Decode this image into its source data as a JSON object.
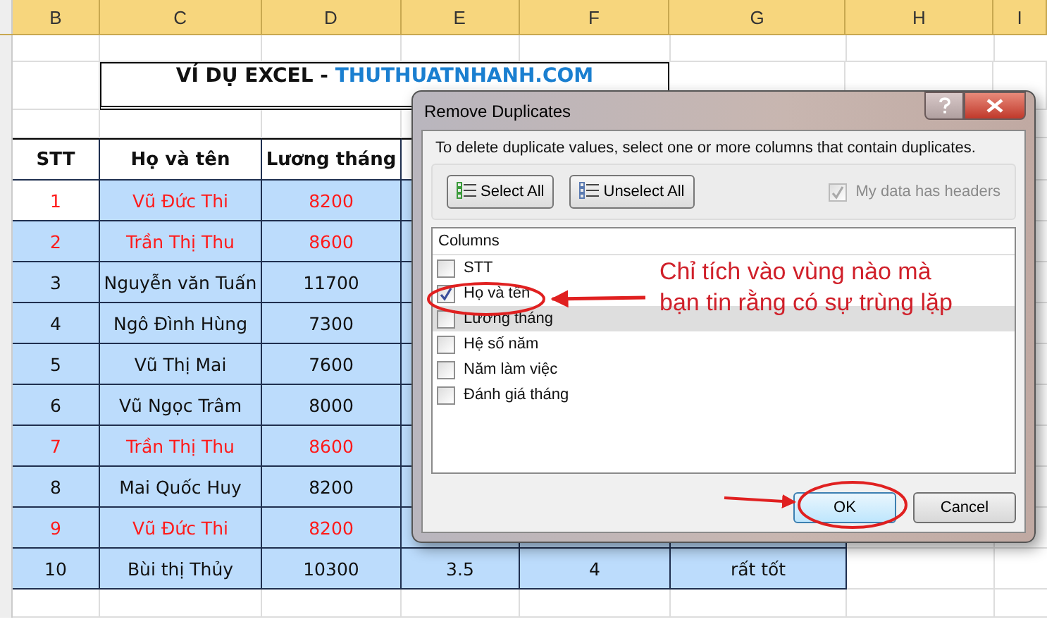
{
  "sheet": {
    "column_letters": [
      "B",
      "C",
      "D",
      "E",
      "F",
      "G",
      "H",
      "I"
    ],
    "title": {
      "text": "VÍ DỤ EXCEL - ",
      "site": "THUTHUATNHANH.COM"
    },
    "headers": [
      "STT",
      "Họ và tên",
      "Lương tháng"
    ],
    "rows": [
      {
        "stt": "1",
        "name": "Vũ Đức Thi",
        "salary": "8200",
        "duplicate": true,
        "active": true
      },
      {
        "stt": "2",
        "name": "Trần Thị Thu",
        "salary": "8600",
        "duplicate": true,
        "active": false
      },
      {
        "stt": "3",
        "name": "Nguyễn văn Tuấn",
        "salary": "11700",
        "duplicate": false,
        "active": false
      },
      {
        "stt": "4",
        "name": "Ngô Đình Hùng",
        "salary": "7300",
        "duplicate": false,
        "active": false
      },
      {
        "stt": "5",
        "name": "Vũ Thị Mai",
        "salary": "7600",
        "duplicate": false,
        "active": false
      },
      {
        "stt": "6",
        "name": "Vũ Ngọc Trâm",
        "salary": "8000",
        "duplicate": false,
        "active": false
      },
      {
        "stt": "7",
        "name": "Trần Thị Thu",
        "salary": "8600",
        "duplicate": true,
        "active": false
      },
      {
        "stt": "8",
        "name": "Mai Quốc Huy",
        "salary": "8200",
        "duplicate": false,
        "active": false
      },
      {
        "stt": "9",
        "name": "Vũ Đức Thi",
        "salary": "8200",
        "duplicate": true,
        "active": false
      },
      {
        "stt": "10",
        "name": "Bùi thị Thủy",
        "salary": "10300",
        "duplicate": false,
        "active": false,
        "extra": [
          "3.5",
          "4",
          "rất tốt"
        ]
      }
    ]
  },
  "dialog": {
    "title": "Remove Duplicates",
    "instruction": "To delete duplicate values, select one or more columns that contain duplicates.",
    "toolbar_buttons": [
      "Select All",
      "Unselect All"
    ],
    "headers_option": {
      "label": "My data has headers",
      "checked": true,
      "disabled": true
    },
    "columns_heading": "Columns",
    "columns": [
      {
        "label": "STT",
        "checked": false,
        "selected": false
      },
      {
        "label": "Họ và tên",
        "checked": true,
        "selected": false
      },
      {
        "label": "Lương tháng",
        "checked": false,
        "selected": true
      },
      {
        "label": "Hệ số năm",
        "checked": false,
        "selected": false
      },
      {
        "label": "Năm làm việc",
        "checked": false,
        "selected": false
      },
      {
        "label": "Đánh giá tháng",
        "checked": false,
        "selected": false
      }
    ],
    "buttons": [
      {
        "label": "OK",
        "default": true
      },
      {
        "label": "Cancel",
        "default": false
      }
    ]
  },
  "annotation": {
    "lines": [
      "Chỉ tích vào vùng nào mà",
      "bạn tin rằng có sự trùng lặp"
    ]
  }
}
